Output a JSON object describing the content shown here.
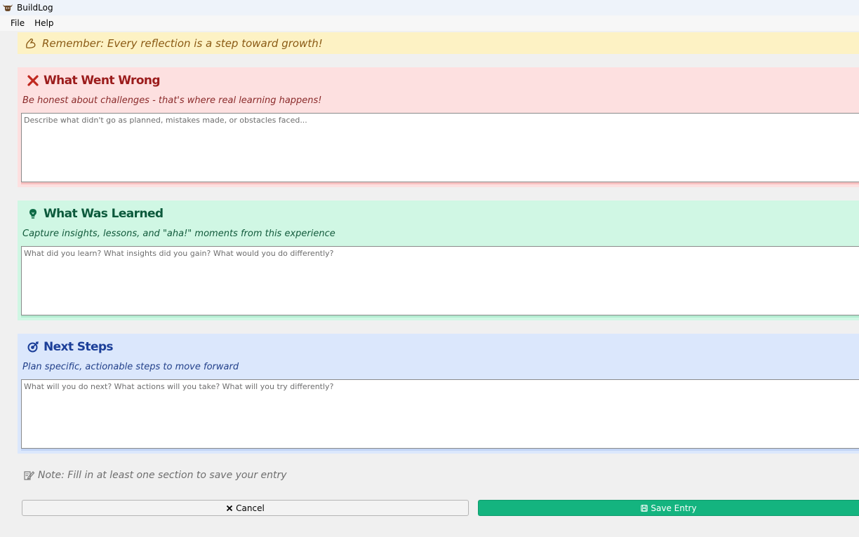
{
  "window": {
    "title": "BuildLog",
    "app_icon": "bull-icon"
  },
  "menu": {
    "items": [
      "File",
      "Help"
    ]
  },
  "banner": {
    "icon": "flexed-arm-icon",
    "text": "Remember: Every reflection is a step toward growth!"
  },
  "sections": {
    "wrong": {
      "icon": "cross-icon",
      "title": "What Went Wrong",
      "subtitle": "Be honest about challenges - that's where real learning happens!",
      "placeholder": "Describe what didn't go as planned, mistakes made, or obstacles faced...",
      "value": "",
      "bg_color": "#fde0e0",
      "accent_color": "#9b1c1c"
    },
    "learned": {
      "icon": "lightbulb-icon",
      "title": "What Was Learned",
      "subtitle": "Capture insights, lessons, and \"aha!\" moments from this experience",
      "placeholder": "What did you learn? What insights did you gain? What would you do differently?",
      "value": "",
      "bg_color": "#d0f7e4",
      "accent_color": "#0c5a3c"
    },
    "next": {
      "icon": "target-icon",
      "title": "Next Steps",
      "subtitle": "Plan specific, actionable steps to move forward",
      "placeholder": "What will you do next? What actions will you take? What will you try differently?",
      "value": "",
      "bg_color": "#dbe7fc",
      "accent_color": "#1c3f99"
    }
  },
  "note": {
    "icon": "memo-icon",
    "text": "Note: Fill in at least one section to save your entry"
  },
  "buttons": {
    "cancel": {
      "icon": "x-icon",
      "label": "Cancel"
    },
    "save": {
      "icon": "floppy-disk-icon",
      "label": "Save Entry",
      "color": "#14b47f"
    }
  }
}
